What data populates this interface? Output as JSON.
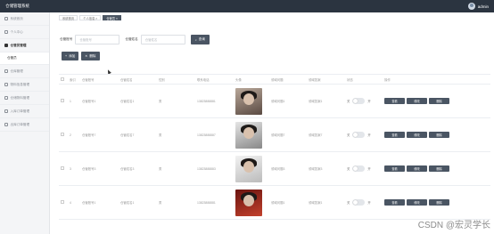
{
  "header": {
    "title": "仓储管理系统",
    "user": "admin"
  },
  "sidebar": {
    "items": [
      {
        "label": "系统首页"
      },
      {
        "label": "个人中心"
      },
      {
        "label": "仓管员管理"
      },
      {
        "label": "仓库管理"
      },
      {
        "label": "物料信息管理"
      },
      {
        "label": "仓储物料管理"
      },
      {
        "label": "入库订单管理"
      },
      {
        "label": "出库订单管理"
      }
    ],
    "sub_item": "仓管员"
  },
  "tabs": [
    "系统首页",
    "个人信息 ×",
    "仓管员 ×"
  ],
  "search": {
    "field1_label": "仓管账号",
    "field1_placeholder": "仓管账号",
    "field2_label": "仓管姓名",
    "field2_placeholder": "仓管姓名",
    "button": "查询"
  },
  "actions": {
    "add": "添加",
    "delete": "删除"
  },
  "table": {
    "columns": [
      "",
      "索引",
      "仓管账号",
      "仓管姓名",
      "性别",
      "联系电话",
      "头像",
      "领域问题",
      "领域答案",
      "状态",
      "操作"
    ],
    "rows": [
      {
        "index": "1",
        "account": "仓管账号1",
        "name": "仓管姓名1",
        "gender": "男",
        "phone": "13823888881",
        "question": "领域问题1",
        "answer": "领域答案1",
        "state_off": "关",
        "state_on": "开"
      },
      {
        "index": "2",
        "account": "仓管账号7",
        "name": "仓管姓名7",
        "gender": "男",
        "phone": "13823888887",
        "question": "领域问题7",
        "answer": "领域答案7",
        "state_off": "关",
        "state_on": "开"
      },
      {
        "index": "3",
        "account": "仓管账号3",
        "name": "仓管姓名3",
        "gender": "男",
        "phone": "13823888883",
        "question": "领域问题3",
        "answer": "领域答案3",
        "state_off": "关",
        "state_on": "开"
      },
      {
        "index": "4",
        "account": "仓管账号1",
        "name": "仓管姓名1",
        "gender": "男",
        "phone": "13823888881",
        "question": "领域问题1",
        "answer": "领域答案1",
        "state_off": "关",
        "state_on": "开"
      }
    ],
    "ops": [
      "查看",
      "修改",
      "删除"
    ]
  },
  "watermark": "CSDN @宏灵学长"
}
